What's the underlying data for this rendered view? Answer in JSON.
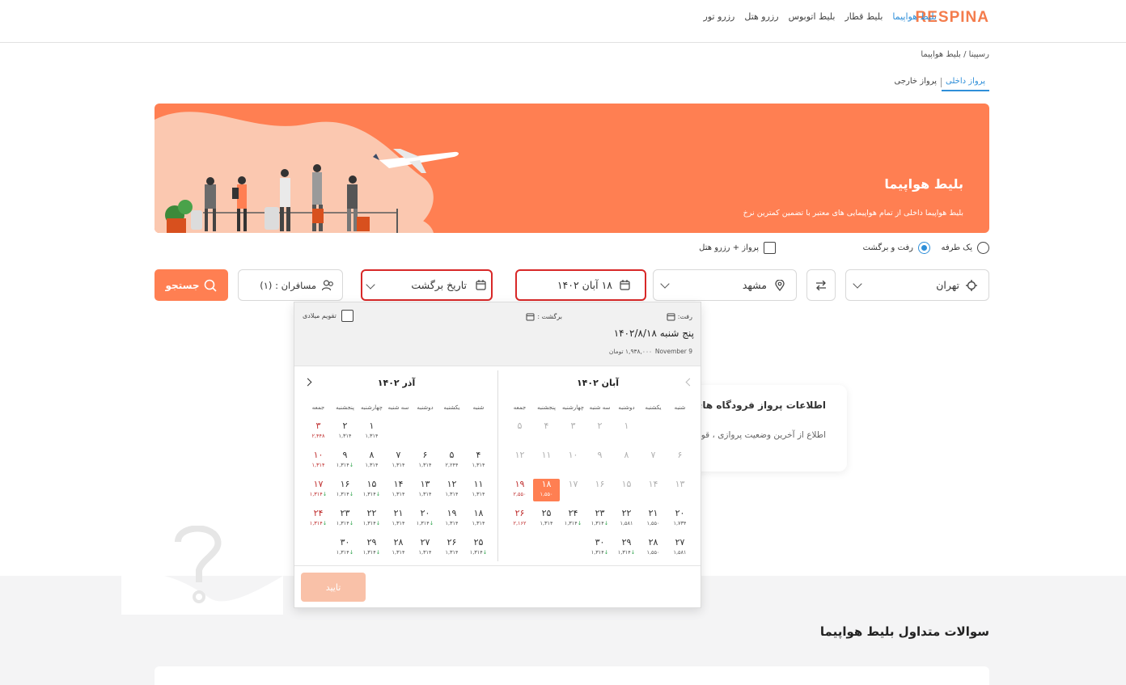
{
  "header": {
    "logo": "RESPINA",
    "nav": [
      "بلیط هواپیما",
      "بلیط قطار",
      "بلیط اتوبوس",
      "رزرو هتل",
      "رزرو تور"
    ],
    "active_index": 0
  },
  "breadcrumb": "رسپینا / بلیط هواپیما",
  "tabs": {
    "domestic": "پرواز داخلی",
    "foreign": "پرواز خارجی"
  },
  "banner": {
    "title": "بلیط هواپیما",
    "subtitle": "بلیط هواپیما داخلی از تمام هواپیمایی های معتبر با تضمین کمترین نرخ"
  },
  "trip": {
    "one_way": "یک طرفه",
    "round_trip": "رفت و برگشت",
    "flight_hotel": "پرواز + رزرو هتل"
  },
  "search": {
    "origin": "تهران",
    "destination": "مشهد",
    "depart": "۱۸ آبان ۱۴۰۲",
    "return_placeholder": "تاریخ برگشت",
    "passengers": "مسافران : (۱)",
    "search_button": "جستجو"
  },
  "colors": {
    "accent": "#ff7f52",
    "link": "#2f8fd9",
    "friday": "#c03030",
    "down": "#2ea34b"
  },
  "datepicker": {
    "go_label": "رفت:",
    "back_label": "برگشت :",
    "selected_date": "پنج شنبه ۱۴۰۲/۸/۱۸",
    "gregorian": "November 9",
    "price": "۱,۹۳۸,۰۰۰ تومان",
    "miladi": "تقویم میلادی",
    "confirm": "تایید",
    "weekdays": [
      "شنبه",
      "یکشنبه",
      "دوشنبه",
      "سه شنبه",
      "چهارشنبه",
      "پنجشنبه",
      "جمعه"
    ],
    "months": [
      {
        "title": "آبان ۱۴۰۲",
        "weeks": [
          [
            null,
            null,
            {
              "d": "۱",
              "dis": true
            },
            {
              "d": "۲",
              "dis": true
            },
            {
              "d": "۳",
              "dis": true
            },
            {
              "d": "۴",
              "dis": true
            },
            {
              "d": "۵",
              "dis": true
            }
          ],
          [
            {
              "d": "۶",
              "dis": true
            },
            {
              "d": "۷",
              "dis": true
            },
            {
              "d": "۸",
              "dis": true
            },
            {
              "d": "۹",
              "dis": true
            },
            {
              "d": "۱۰",
              "dis": true
            },
            {
              "d": "۱۱",
              "dis": true
            },
            {
              "d": "۱۲",
              "dis": true
            }
          ],
          [
            {
              "d": "۱۳",
              "dis": true
            },
            {
              "d": "۱۴",
              "dis": true
            },
            {
              "d": "۱۵",
              "dis": true
            },
            {
              "d": "۱۶",
              "dis": true
            },
            {
              "d": "۱۷",
              "dis": true
            },
            {
              "d": "۱۸",
              "p": "۱,۵۵۰",
              "sel": true
            },
            {
              "d": "۱۹",
              "p": "۲,۵۵۰",
              "fri": true
            }
          ],
          [
            {
              "d": "۲۰",
              "p": "۱,۷۳۴"
            },
            {
              "d": "۲۱",
              "p": "۱,۵۵۰"
            },
            {
              "d": "۲۲",
              "p": "۱,۵۸۱"
            },
            {
              "d": "۲۳",
              "p": "۱,۳۱۴",
              "dn": true
            },
            {
              "d": "۲۴",
              "p": "۱,۳۱۴",
              "dn": true
            },
            {
              "d": "۲۵",
              "p": "۱,۳۱۴"
            },
            {
              "d": "۲۶",
              "p": "۲,۱۶۲",
              "fri": true
            }
          ],
          [
            {
              "d": "۲۷",
              "p": "۱,۵۸۱"
            },
            {
              "d": "۲۸",
              "p": "۱,۵۵۰"
            },
            {
              "d": "۲۹",
              "p": "۱,۳۱۴",
              "dn": true
            },
            {
              "d": "۳۰",
              "p": "۱,۳۱۴",
              "dn": true
            },
            null,
            null,
            null
          ]
        ]
      },
      {
        "title": "آذر ۱۴۰۲",
        "weeks": [
          [
            null,
            null,
            null,
            null,
            {
              "d": "۱",
              "p": "۱,۳۱۴"
            },
            {
              "d": "۲",
              "p": "۱,۳۱۴"
            },
            {
              "d": "۳",
              "p": "۲,۴۴۸",
              "fri": true
            }
          ],
          [
            {
              "d": "۴",
              "p": "۱,۳۱۴"
            },
            {
              "d": "۵",
              "p": "۲,۲۴۴"
            },
            {
              "d": "۶",
              "p": "۱,۳۱۴"
            },
            {
              "d": "۷",
              "p": "۱,۳۱۴"
            },
            {
              "d": "۸",
              "p": "۱,۳۱۴"
            },
            {
              "d": "۹",
              "p": "۱,۳۱۴",
              "dn": true
            },
            {
              "d": "۱۰",
              "p": "۱,۳۱۴",
              "fri": true
            }
          ],
          [
            {
              "d": "۱۱",
              "p": "۱,۳۱۴"
            },
            {
              "d": "۱۲",
              "p": "۱,۳۱۴"
            },
            {
              "d": "۱۳",
              "p": "۱,۳۱۴"
            },
            {
              "d": "۱۴",
              "p": "۱,۳۱۴"
            },
            {
              "d": "۱۵",
              "p": "۱,۳۱۴",
              "dn": true
            },
            {
              "d": "۱۶",
              "p": "۱,۳۱۴",
              "dn": true
            },
            {
              "d": "۱۷",
              "p": "۱,۳۱۴",
              "fri": true,
              "dn": true
            }
          ],
          [
            {
              "d": "۱۸",
              "p": "۱,۳۱۴"
            },
            {
              "d": "۱۹",
              "p": "۱,۳۱۴"
            },
            {
              "d": "۲۰",
              "p": "۱,۳۱۴",
              "dn": true
            },
            {
              "d": "۲۱",
              "p": "۱,۳۱۴"
            },
            {
              "d": "۲۲",
              "p": "۱,۳۱۴",
              "dn": true
            },
            {
              "d": "۲۳",
              "p": "۱,۳۱۴",
              "dn": true
            },
            {
              "d": "۲۴",
              "p": "۱,۳۱۴",
              "fri": true,
              "dn": true
            }
          ],
          [
            {
              "d": "۲۵",
              "p": "۱,۳۱۴",
              "dn": true
            },
            {
              "d": "۲۶",
              "p": "۱,۳۱۴"
            },
            {
              "d": "۲۷",
              "p": "۱,۳۱۴"
            },
            {
              "d": "۲۸",
              "p": "۱,۳۱۴"
            },
            {
              "d": "۲۹",
              "p": "۱,۳۱۴",
              "dn": true
            },
            {
              "d": "۳۰",
              "p": "۱,۳۱۴",
              "dn": true
            },
            null
          ]
        ]
      }
    ]
  },
  "info_card": {
    "title": "اطلاعات پرواز فرودگاه های کشور",
    "subtitle": "اطلاع از آخرین وضعیت پروازی ، قوانین"
  },
  "faq_title": "سوالات متداول بلیط هواپیما"
}
